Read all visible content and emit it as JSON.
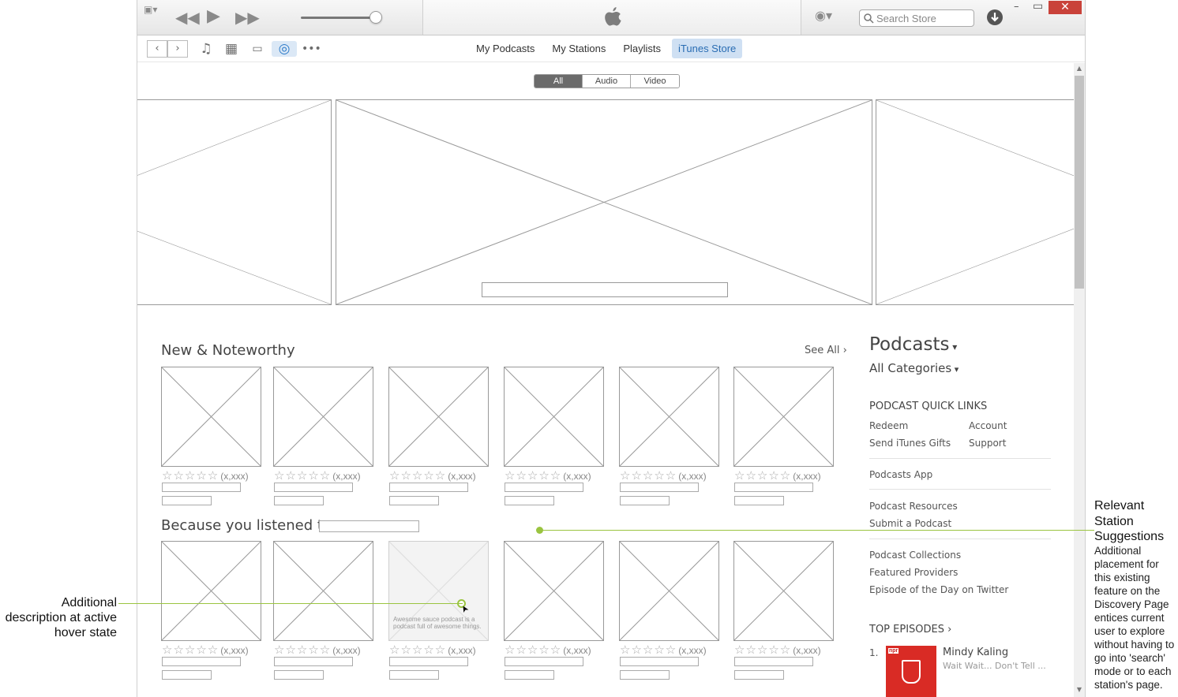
{
  "window": {
    "search_placeholder": "Search Store",
    "close_glyph": "✕",
    "minimize_glyph": "–",
    "maximize_glyph": "▭"
  },
  "navbar": {
    "tabs": [
      {
        "label": "My Podcasts",
        "active": false
      },
      {
        "label": "My Stations",
        "active": false
      },
      {
        "label": "Playlists",
        "active": false
      },
      {
        "label": "iTunes Store",
        "active": true
      }
    ]
  },
  "filter": {
    "options": [
      "All",
      "Audio",
      "Video"
    ],
    "selected": "All"
  },
  "new_noteworthy": {
    "title": "New & Noteworthy",
    "see_all": "See All",
    "rating_count": "(x,xxx)"
  },
  "because": {
    "title": "Because you listened to",
    "hover_description": "Awesome sauce podcast is a podcast full of awesome things.",
    "rating_count": "(x,xxx)"
  },
  "sidebar": {
    "title": "Podcasts",
    "category": "All Categories",
    "quick_links_heading": "PODCAST QUICK LINKS",
    "quick_links": [
      "Redeem",
      "Account",
      "Send iTunes Gifts",
      "Support"
    ],
    "app_link": "Podcasts App",
    "resources": [
      "Podcast Resources",
      "Submit a Podcast"
    ],
    "collections": [
      "Podcast Collections",
      "Featured Providers",
      "Episode of the Day on Twitter"
    ],
    "top_episodes_heading": "TOP EPISODES",
    "top_episode": {
      "rank": "1.",
      "title": "Mindy Kaling",
      "subtitle": "Wait Wait... Don't Tell ...",
      "badge": "npr"
    }
  },
  "annotations": {
    "left": "Additional description at active hover state",
    "right_title": "Relevant Station Suggestions",
    "right_body": "Additional placement for this existing feature on the Discovery Page entices current user to explore without having to go into 'search' mode or to each station's page.",
    "line_color": "#9ac440"
  }
}
